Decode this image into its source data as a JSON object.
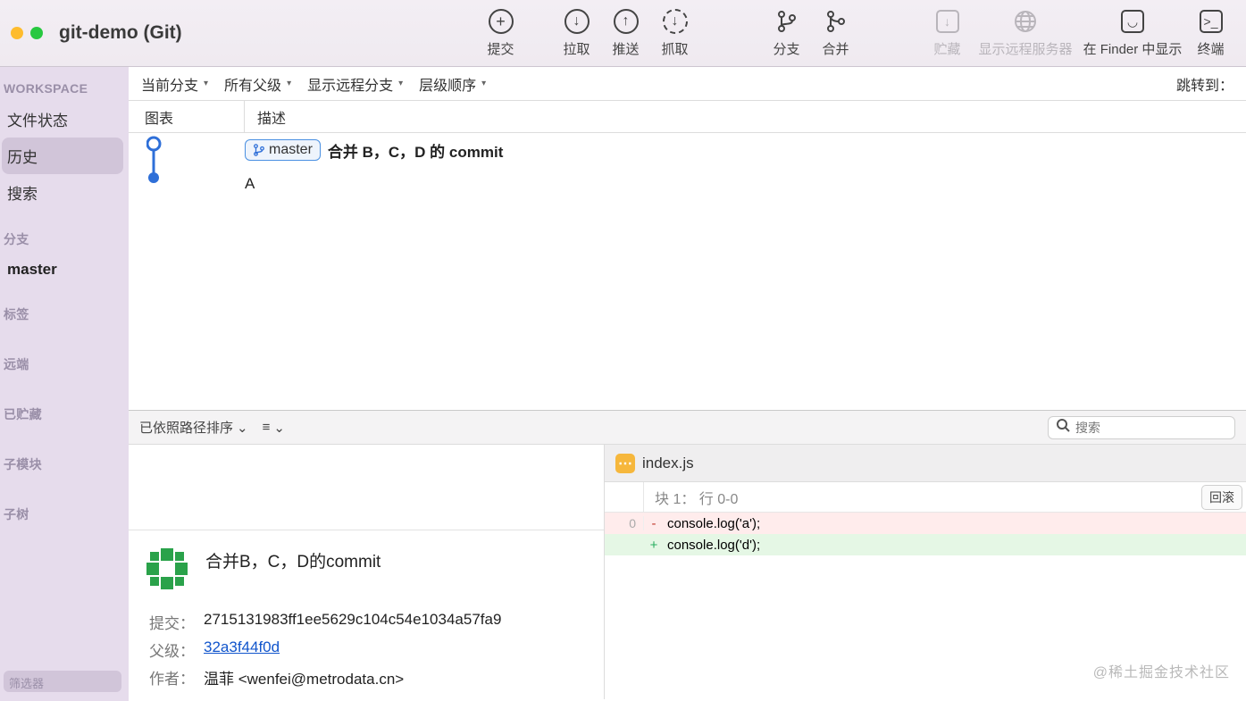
{
  "window": {
    "title": "git-demo (Git)"
  },
  "toolbar": {
    "commit": "提交",
    "pull": "拉取",
    "push": "推送",
    "fetch": "抓取",
    "branch": "分支",
    "merge": "合并",
    "stash": "贮藏",
    "show_remote": "显示远程服务器",
    "show_in_finder": "在 Finder 中显示",
    "terminal": "终端"
  },
  "sidebar": {
    "workspace_heading": "WORKSPACE",
    "file_status": "文件状态",
    "history": "历史",
    "search": "搜索",
    "branches_heading": "分支",
    "branch_master": "master",
    "tags_heading": "标签",
    "remotes_heading": "远端",
    "stashed_heading": "已贮藏",
    "submodules_heading": "子模块",
    "subtrees_heading": "子树",
    "filter_placeholder": "筛选器"
  },
  "filterbar": {
    "current_branch": "当前分支",
    "all_parents": "所有父级",
    "show_remote_branches": "显示远程分支",
    "hierarchy_order": "层级顺序",
    "jump_to": "跳转到："
  },
  "columns": {
    "chart": "图表",
    "description": "描述"
  },
  "commits": [
    {
      "branch_tag": "master",
      "message": "合并 B，C，D 的 commit"
    },
    {
      "branch_tag": "",
      "message": "A"
    }
  ],
  "lower_toolbar": {
    "sort_label": "已依照路径排序",
    "search_placeholder": "搜索"
  },
  "commit_detail": {
    "title": "合并B，C，D的commit",
    "labels": {
      "commit": "提交：",
      "parent": "父级：",
      "author": "作者："
    },
    "commit_hash": "2715131983ff1ee5629c104c54e1034a57fa9",
    "parent_hash": "32a3f44f0d",
    "author": "温菲 <wenfei@metrodata.cn>"
  },
  "diff": {
    "file_name": "index.js",
    "hunk_label": "块 1：  行 0-0",
    "revert_btn": "回滚",
    "lines": [
      {
        "ln": "0",
        "sign": "-",
        "code": "console.log('a');",
        "type": "removed"
      },
      {
        "ln": "",
        "sign": "+",
        "code": "console.log('d');",
        "type": "added"
      }
    ]
  },
  "watermark": "@稀土掘金技术社区"
}
